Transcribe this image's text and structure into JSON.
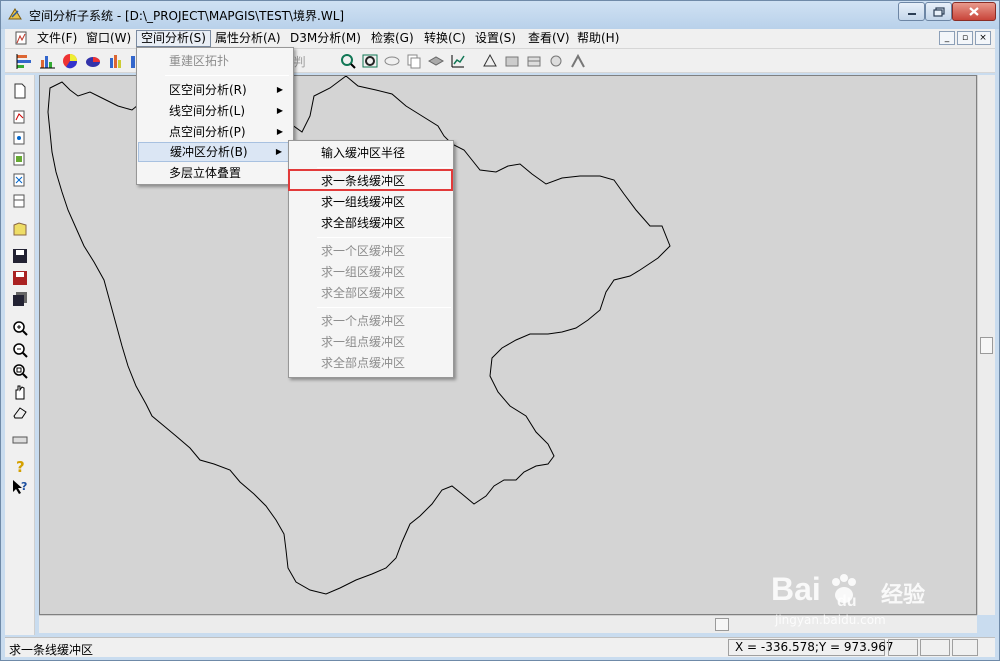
{
  "window": {
    "title": "空间分析子系统 - [D:\\_PROJECT\\MAPGIS\\TEST\\境界.WL]"
  },
  "menubar": {
    "items": [
      {
        "label": "文件(F)"
      },
      {
        "label": "窗口(W)"
      },
      {
        "label": "空间分析(S)"
      },
      {
        "label": "属性分析(A)"
      },
      {
        "label": "D3M分析(M)"
      },
      {
        "label": "检索(G)"
      },
      {
        "label": "转换(C)"
      },
      {
        "label": "设置(S)"
      },
      {
        "label": "查看(V)"
      },
      {
        "label": "帮助(H)"
      }
    ]
  },
  "spatial_menu": {
    "items": [
      {
        "label": "重建区拓扑"
      },
      {
        "label": "区空间分析(R)"
      },
      {
        "label": "线空间分析(L)"
      },
      {
        "label": "点空间分析(P)"
      },
      {
        "label": "缓冲区分析(B)"
      },
      {
        "label": "多层立体叠置"
      }
    ]
  },
  "buffer_menu": {
    "items": [
      {
        "label": "输入缓冲区半径"
      },
      {
        "label": "求一条线缓冲区"
      },
      {
        "label": "求一组线缓冲区"
      },
      {
        "label": "求全部线缓冲区"
      },
      {
        "label": "求一个区缓冲区"
      },
      {
        "label": "求一组区缓冲区"
      },
      {
        "label": "求全部区缓冲区"
      },
      {
        "label": "求一个点缓冲区"
      },
      {
        "label": "求一组点缓冲区"
      },
      {
        "label": "求全部点缓冲区"
      }
    ]
  },
  "statusbar": {
    "message": "求一条线缓冲区",
    "coords": "X = -336.578;Y = 973.967"
  },
  "watermark": {
    "brand": "Bai",
    "brand2": "du",
    "cn": "经验",
    "url": "jingyan.baidu.com"
  },
  "colors": {
    "map_bg": "#d4d4d4",
    "highlight": "#e23a3a",
    "title_bar": "#c9dcef"
  }
}
